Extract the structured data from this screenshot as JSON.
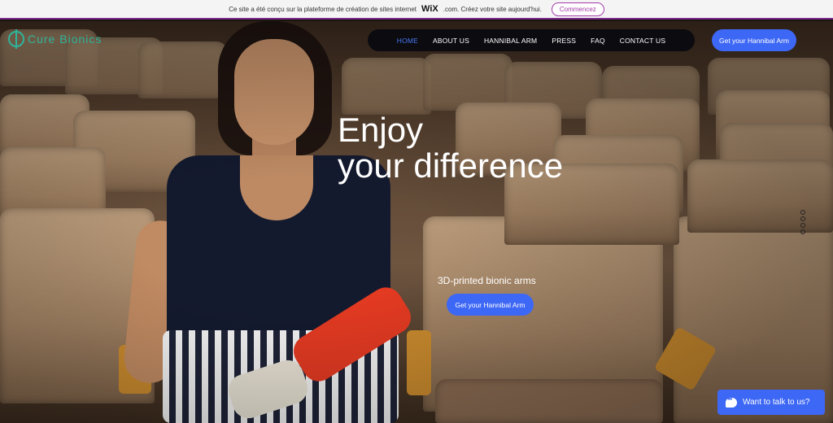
{
  "banner": {
    "text_before": "Ce site a été conçu sur la plateforme de création de sites internet",
    "wix": "WiX",
    "text_after": ".com. Créez votre site aujourd'hui.",
    "button": "Commencez"
  },
  "logo": {
    "text": "Cure Bionics"
  },
  "nav": {
    "items": [
      "HOME",
      "ABOUT US",
      "HANNIBAL ARM",
      "PRESS",
      "FAQ",
      "CONTACT US"
    ],
    "active": "HOME"
  },
  "header_cta": "Get your Hannibal Arm",
  "hero": {
    "headline_line1": "Enjoy",
    "headline_line2": "your difference",
    "subhead": "3D-printed bionic arms",
    "cta": "Get your Hannibal Arm"
  },
  "chat": {
    "label": "Want to talk to us?"
  },
  "colors": {
    "accent": "#3d67f5",
    "logo": "#2fb39a",
    "nav_bg": "#0b0b10",
    "cast": "#e33a22"
  },
  "icons": {
    "chat": "chat-bubble-icon",
    "logo": "cure-bionics-logo-icon"
  }
}
